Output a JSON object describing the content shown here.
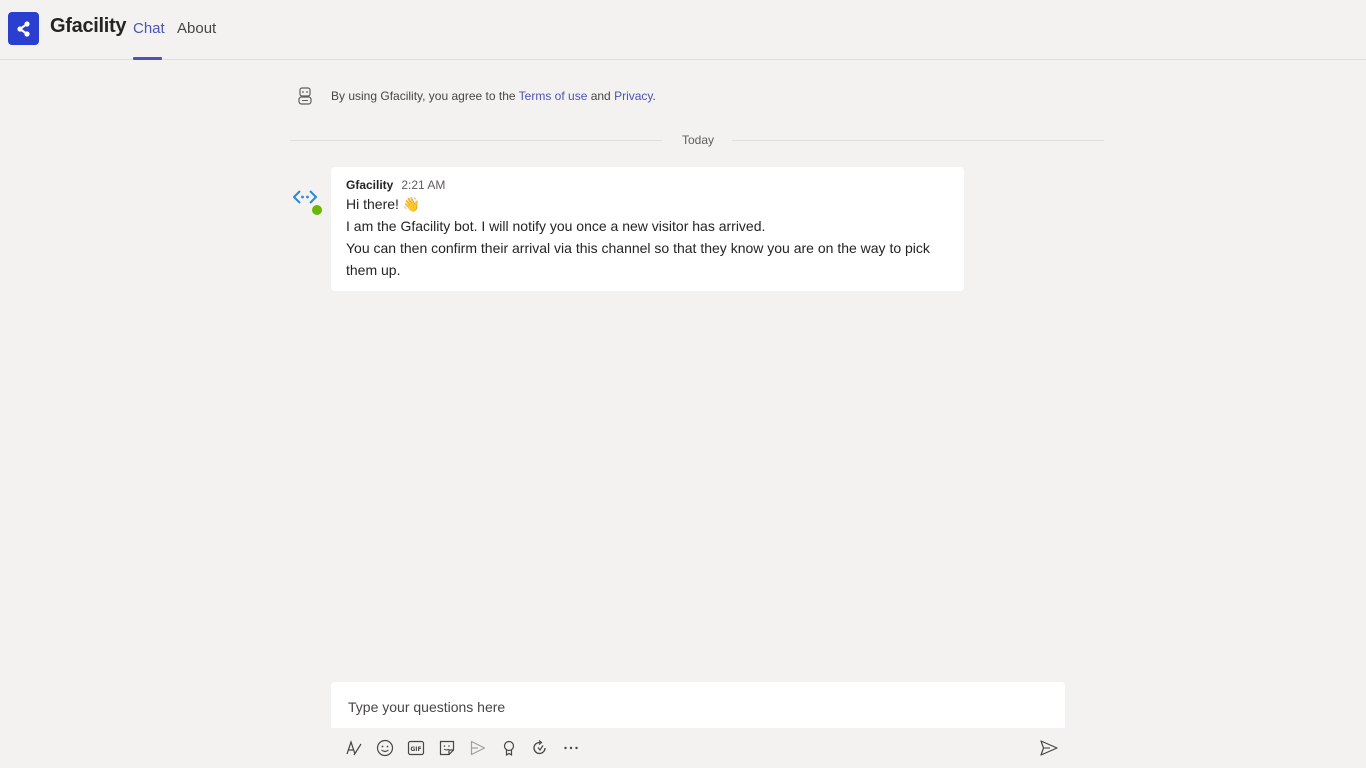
{
  "header": {
    "app_title": "Gfacility",
    "tabs": [
      {
        "label": "Chat",
        "active": true
      },
      {
        "label": "About",
        "active": false
      }
    ],
    "accent_color": "#4f52b2",
    "logo_color": "#2a3fd0"
  },
  "notice": {
    "prefix": "By using Gfacility, you agree to the ",
    "terms_link": "Terms of use",
    "middle": " and ",
    "privacy_link": "Privacy",
    "suffix": "."
  },
  "divider": {
    "label": "Today"
  },
  "message": {
    "sender": "Gfacility",
    "time": "2:21 AM",
    "greeting": "Hi there! 👋",
    "line1": "I am the Gfacility bot. I will notify you once a new visitor has arrived.",
    "line2": "You can then confirm their arrival via this channel so that they know you are on the way to pick them up."
  },
  "compose": {
    "placeholder": "Type your questions here",
    "toolbar_icons": [
      "format-icon",
      "emoji-icon",
      "gif-icon",
      "sticker-icon",
      "meet-now-icon",
      "praise-icon",
      "loop-icon",
      "more-options-icon"
    ],
    "send_icon": "send-icon"
  }
}
